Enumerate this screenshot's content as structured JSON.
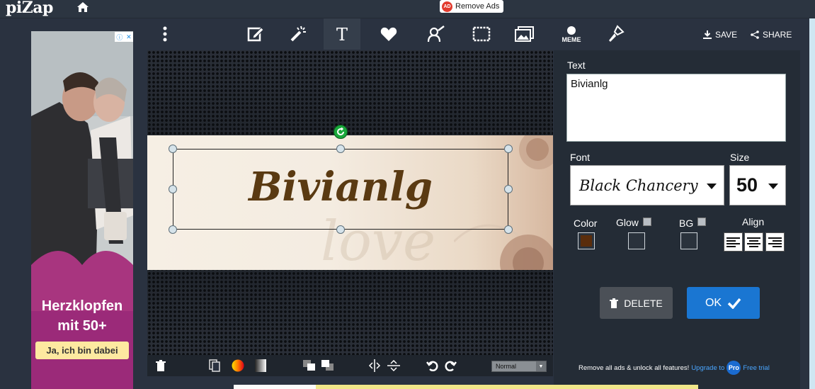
{
  "header": {
    "logo": "piZap",
    "remove_ads_badge": "AD",
    "remove_ads_label": "Remove Ads"
  },
  "toolbar": {
    "tools": [
      {
        "name": "more-menu",
        "icon": "vertical-dots-icon"
      },
      {
        "name": "edit",
        "icon": "edit-pencil-icon"
      },
      {
        "name": "effects",
        "icon": "magic-wand-icon"
      },
      {
        "name": "text",
        "icon": "text-t-icon",
        "active": true
      },
      {
        "name": "stickers",
        "icon": "heart-icon"
      },
      {
        "name": "touch-up",
        "icon": "face-brush-icon"
      },
      {
        "name": "frames",
        "icon": "frame-icon"
      },
      {
        "name": "add-photo",
        "icon": "photo-add-icon"
      },
      {
        "name": "meme",
        "icon": "meme-icon",
        "label": "MEME"
      },
      {
        "name": "paint",
        "icon": "paintbrush-icon"
      }
    ],
    "save_label": "SAVE",
    "share_label": "SHARE"
  },
  "ad": {
    "headline_line1": "Herzklopfen",
    "headline_line2": "mit 50+",
    "cta": "Ja, ich bin dabei"
  },
  "canvas": {
    "text": "Bivianlg",
    "text_color": "#5a3a12",
    "background_word": "love"
  },
  "bottom_toolbar": {
    "blend_mode": "Normal"
  },
  "panel": {
    "text_label": "Text",
    "text_value": "Bivianlg",
    "font_label": "Font",
    "font_value": "Black Chancery",
    "size_label": "Size",
    "size_value": "50",
    "color_label": "Color",
    "color_value": "#5a2d0c",
    "glow_label": "Glow",
    "bg_label": "BG",
    "align_label": "Align",
    "delete_label": "DELETE",
    "ok_label": "OK",
    "promo_text": "Remove all ads & unlock all features!",
    "promo_link": "Upgrade to",
    "promo_badge": "Pro",
    "promo_trial": "Free trial"
  }
}
